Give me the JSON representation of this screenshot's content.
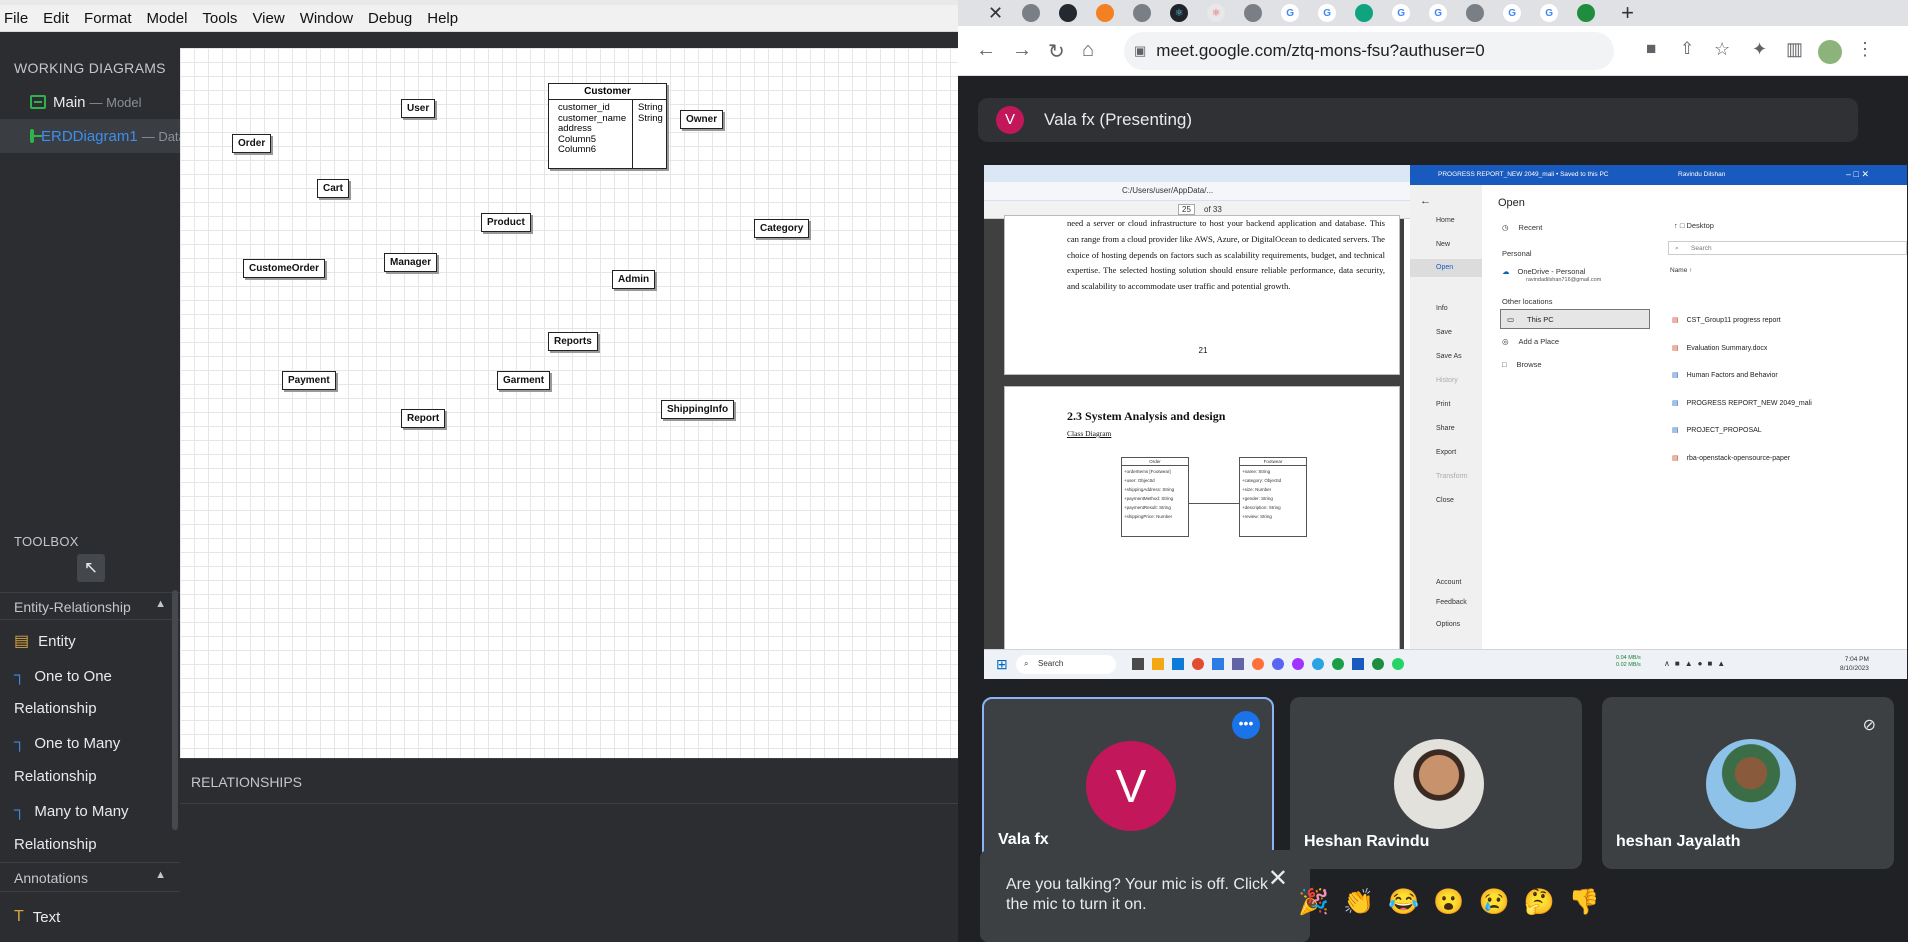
{
  "menu": [
    "File",
    "Edit",
    "Format",
    "Model",
    "Tools",
    "View",
    "Window",
    "Debug",
    "Help"
  ],
  "sidebar": {
    "title": "WORKING DIAGRAMS",
    "items": [
      {
        "name": "Main",
        "suffix": "— Model"
      },
      {
        "name": "ERDDiagram1",
        "suffix": "— Data"
      }
    ]
  },
  "diagram": {
    "entities": [
      "User",
      "Order",
      "Cart",
      "Product",
      "Owner",
      "Category",
      "CustomeOrder",
      "Manager",
      "Admin",
      "Reports",
      "Payment",
      "Garment",
      "Report",
      "ShippingInfo"
    ],
    "customer": {
      "title": "Customer",
      "columns": [
        "customer_id",
        "customer_name",
        "address",
        "Column5",
        "Column6"
      ],
      "types": [
        "String",
        "String"
      ]
    }
  },
  "relationships_title": "RELATIONSHIPS",
  "toolbox": {
    "title": "TOOLBOX",
    "section1": "Entity-Relationship",
    "items": [
      "Entity",
      "One to One",
      "Relationship",
      "One to Many",
      "Relationship",
      "Many to Many",
      "Relationship"
    ],
    "section2": "Annotations",
    "annot_item": "Text"
  },
  "browser": {
    "url": "meet.google.com/ztq-mons-fsu?authuser=0"
  },
  "meet": {
    "presenter_initial": "V",
    "presenter_label": "Vala fx (Presenting)",
    "participants": [
      {
        "name": "Vala fx",
        "initial": "V"
      },
      {
        "name": "Heshan Ravindu"
      },
      {
        "name": "heshan Jayalath"
      }
    ],
    "toast": "Are you talking? Your mic is off. Click the mic to turn it on.",
    "reactions": [
      "🎉",
      "👏",
      "😂",
      "😮",
      "😢",
      "🤔",
      "👎"
    ]
  },
  "shared": {
    "pdf": {
      "addr": "C:/Users/user/AppData/...",
      "page_current": "25",
      "page_total": "of 33",
      "paragraph": "need a server or cloud infrastructure to host your backend application and database. This can range from a cloud provider like AWS, Azure, or DigitalOcean to dedicated servers. The choice of hosting depends on factors such as scalability requirements, budget, and technical expertise. The selected hosting solution should ensure reliable performance, data security, and scalability to accommodate user traffic and potential growth.",
      "page_no": "21",
      "heading": "2.3 System Analysis and design",
      "subheading": "Class Diagram",
      "class1_title": "Order",
      "class1_attrs": [
        "+orderItems [Footwear]",
        "+user: ObjectId",
        "+shippingAddress: String",
        "+paymentMethod: String",
        "+paymentResult: String",
        "+shippingPrice: Number"
      ],
      "class2_title": "Footwear",
      "class2_attrs": [
        "+name: String",
        "+category: ObjectId",
        "+size: Number",
        "+gender: String",
        "+description: String",
        "+review: String"
      ]
    },
    "word": {
      "titlebar": "PROGRESS REPORT_NEW 2049_mali • Saved to this PC",
      "user": "Ravindu Dilshan",
      "open": "Open",
      "nav": [
        "Home",
        "New",
        "Open",
        "Info",
        "Save",
        "Save As",
        "History",
        "Print",
        "Share",
        "Export",
        "Transform",
        "Close",
        "Account",
        "Feedback",
        "Options"
      ],
      "recent": "Recent",
      "personal": "Personal",
      "onedrive": "OneDrive - Personal",
      "email": "ravindadilshan716@gmail.com",
      "other": "Other locations",
      "thispc": "This PC",
      "addplace": "Add a Place",
      "browse": "Browse",
      "desktop": "Desktop",
      "search": "Search",
      "name_col": "Name ↑",
      "files": [
        "CST_Group11 progress report",
        "Evaluation Summary.docx",
        "Human Factors and Behavior",
        "PROGRESS REPORT_NEW 2049_mali",
        "PROJECT_PROPOSAL",
        "rba-openstack-opensource-paper"
      ]
    },
    "taskbar": {
      "search": "Search",
      "time": "7:04 PM",
      "date": "8/10/2023",
      "net1": "0.04 MB/s",
      "net2": "0.02 MB/s"
    }
  }
}
